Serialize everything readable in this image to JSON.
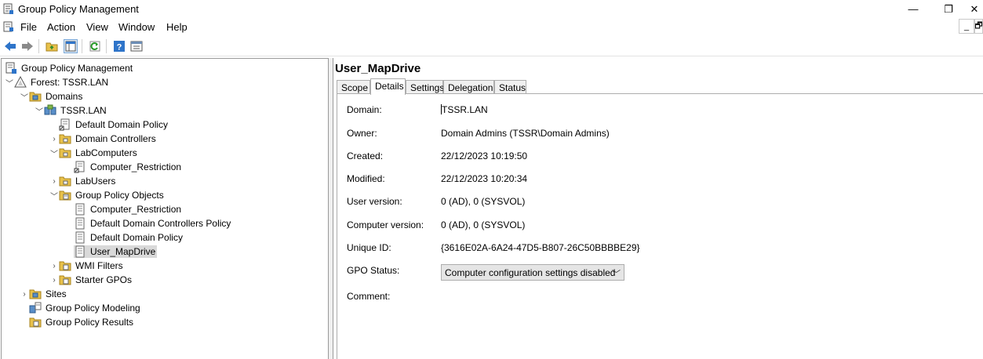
{
  "window": {
    "title": "Group Policy Management",
    "min_glyph": "—",
    "restore_glyph": "❐",
    "close_glyph": "✕"
  },
  "menu": [
    "File",
    "Action",
    "View",
    "Window",
    "Help"
  ],
  "mdi": {
    "min_glyph": "_",
    "restore_glyph": "🗗"
  },
  "toolbar": [
    "back-icon",
    "forward-icon",
    "up-folder-icon",
    "show-hide-tree-icon",
    "refresh-icon",
    "help-icon",
    "properties-icon"
  ],
  "tree": {
    "root": "Group Policy Management",
    "forest": "Forest: TSSR.LAN",
    "domains": "Domains",
    "domain": "TSSR.LAN",
    "default_domain_policy": "Default Domain Policy",
    "domain_controllers": "Domain Controllers",
    "lab_computers": "LabComputers",
    "computer_restriction_link": "Computer_Restriction",
    "lab_users": "LabUsers",
    "gpo_container": "Group Policy Objects",
    "gpos": [
      "Computer_Restriction",
      "Default Domain Controllers Policy",
      "Default Domain Policy",
      "User_MapDrive"
    ],
    "wmi_filters": "WMI Filters",
    "starter_gpos": "Starter GPOs",
    "sites": "Sites",
    "modeling": "Group Policy Modeling",
    "results": "Group Policy Results"
  },
  "details": {
    "title": "User_MapDrive",
    "tabs": [
      "Scope",
      "Details",
      "Settings",
      "Delegation",
      "Status"
    ],
    "active_tab": "Details",
    "fields": {
      "domain_label": "Domain:",
      "domain_value": "TSSR.LAN",
      "owner_label": "Owner:",
      "owner_value": "Domain Admins (TSSR\\Domain Admins)",
      "created_label": "Created:",
      "created_value": "22/12/2023 10:19:50",
      "modified_label": "Modified:",
      "modified_value": "22/12/2023 10:20:34",
      "user_version_label": "User version:",
      "user_version_value": "0 (AD), 0 (SYSVOL)",
      "computer_version_label": "Computer version:",
      "computer_version_value": "0 (AD), 0 (SYSVOL)",
      "unique_id_label": "Unique ID:",
      "unique_id_value": "{3616E02A-6A24-47D5-B807-26C50BBBBE29}",
      "gpo_status_label": "GPO Status:",
      "gpo_status_value": "Computer configuration settings disabled",
      "comment_label": "Comment:"
    }
  },
  "colors": {
    "selected_bg": "#d9d9d9",
    "folder": "#e8c14a",
    "accent_blue": "#2e74c9"
  }
}
